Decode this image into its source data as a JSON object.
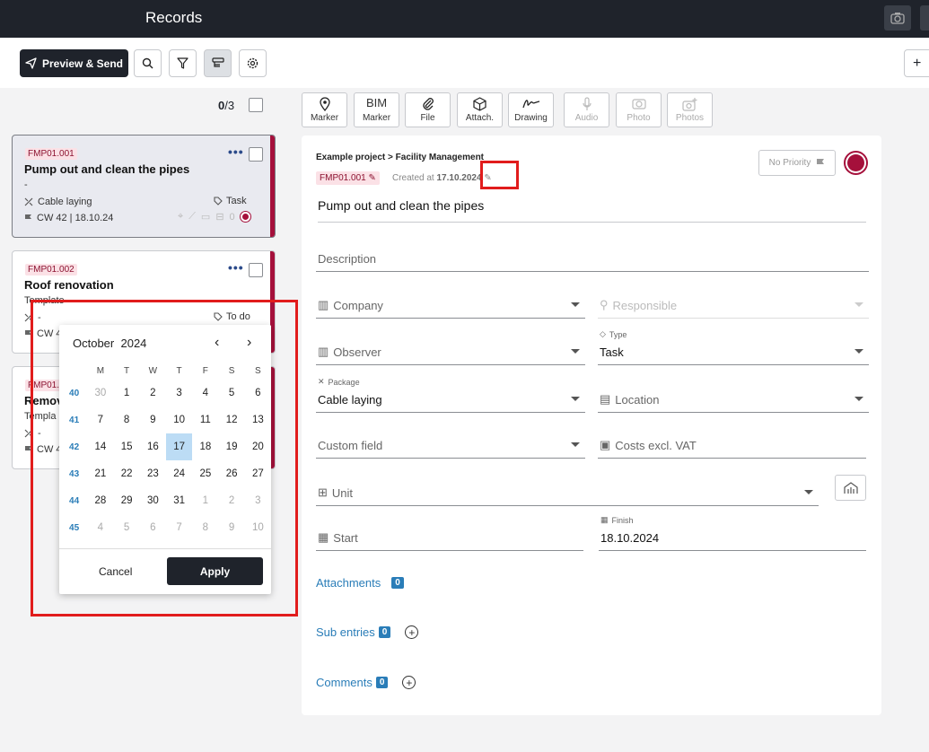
{
  "app": {
    "title": "Records"
  },
  "toolbar": {
    "preview_label": "Preview & Send",
    "plus_label": "+"
  },
  "list": {
    "count_selected": "0",
    "count_total": "/3"
  },
  "cards": [
    {
      "code": "FMP01.001",
      "title": "Pump out and clean the pipes",
      "subtitle": "-",
      "package": "Cable laying",
      "type": "Task",
      "cw": "CW 42 | 18.10.24",
      "comments": "0"
    },
    {
      "code": "FMP01.002",
      "title": "Roof renovation",
      "subtitle": "Template",
      "package": "-",
      "type": "To do",
      "cw": "CW 4"
    },
    {
      "code": "FMP01.0",
      "title": "Remov",
      "subtitle": "Templa",
      "package": "-",
      "cw": "CW 4"
    }
  ],
  "attach_buttons": [
    {
      "label": "Marker",
      "icon": "marker-icon"
    },
    {
      "label": "Marker",
      "top": "BIM",
      "icon": "bim-marker"
    },
    {
      "label": "File",
      "icon": "paperclip-icon"
    },
    {
      "label": "Attach.",
      "icon": "cube-icon"
    },
    {
      "label": "Drawing",
      "icon": "signature-icon"
    },
    {
      "label": "Audio",
      "icon": "microphone-icon"
    },
    {
      "label": "Photo",
      "icon": "camera-icon"
    },
    {
      "label": "Photos",
      "icon": "camera-plus-icon"
    }
  ],
  "detail": {
    "breadcrumb": "Example project > Facility Management",
    "code": "FMP01.001",
    "created_label": "Created at",
    "created_date": "17.10.2024",
    "priority": "No Priority",
    "title": "Pump out and clean the pipes",
    "description_ph": "Description",
    "company_ph": "Company",
    "responsible_ph": "Responsible",
    "observer_ph": "Observer",
    "type_label": "Type",
    "type_value": "Task",
    "package_label": "Package",
    "package_value": "Cable laying",
    "location_ph": "Location",
    "custom_ph": "Custom field",
    "costs_ph": "Costs excl. VAT",
    "unit_ph": "Unit",
    "start_ph": "Start",
    "finish_label": "Finish",
    "finish_value": "18.10.2024",
    "attachments_label": "Attachments",
    "attachments_count": "0",
    "subentries_label": "Sub entries",
    "subentries_count": "0",
    "comments_label": "Comments",
    "comments_count": "0",
    "accent_color": "#a5103b"
  },
  "calendar": {
    "month": "October",
    "year": "2024",
    "weekdays": [
      "M",
      "T",
      "W",
      "T",
      "F",
      "S",
      "S"
    ],
    "weeks": [
      {
        "wk": "40",
        "days": [
          "30",
          "1",
          "2",
          "3",
          "4",
          "5",
          "6"
        ]
      },
      {
        "wk": "41",
        "days": [
          "7",
          "8",
          "9",
          "10",
          "11",
          "12",
          "13"
        ]
      },
      {
        "wk": "42",
        "days": [
          "14",
          "15",
          "16",
          "17",
          "18",
          "19",
          "20"
        ]
      },
      {
        "wk": "43",
        "days": [
          "21",
          "22",
          "23",
          "24",
          "25",
          "26",
          "27"
        ]
      },
      {
        "wk": "44",
        "days": [
          "28",
          "29",
          "30",
          "31",
          "1",
          "2",
          "3"
        ]
      },
      {
        "wk": "45",
        "days": [
          "4",
          "5",
          "6",
          "7",
          "8",
          "9",
          "10"
        ]
      }
    ],
    "selected_day": "17",
    "cancel_label": "Cancel",
    "apply_label": "Apply"
  }
}
